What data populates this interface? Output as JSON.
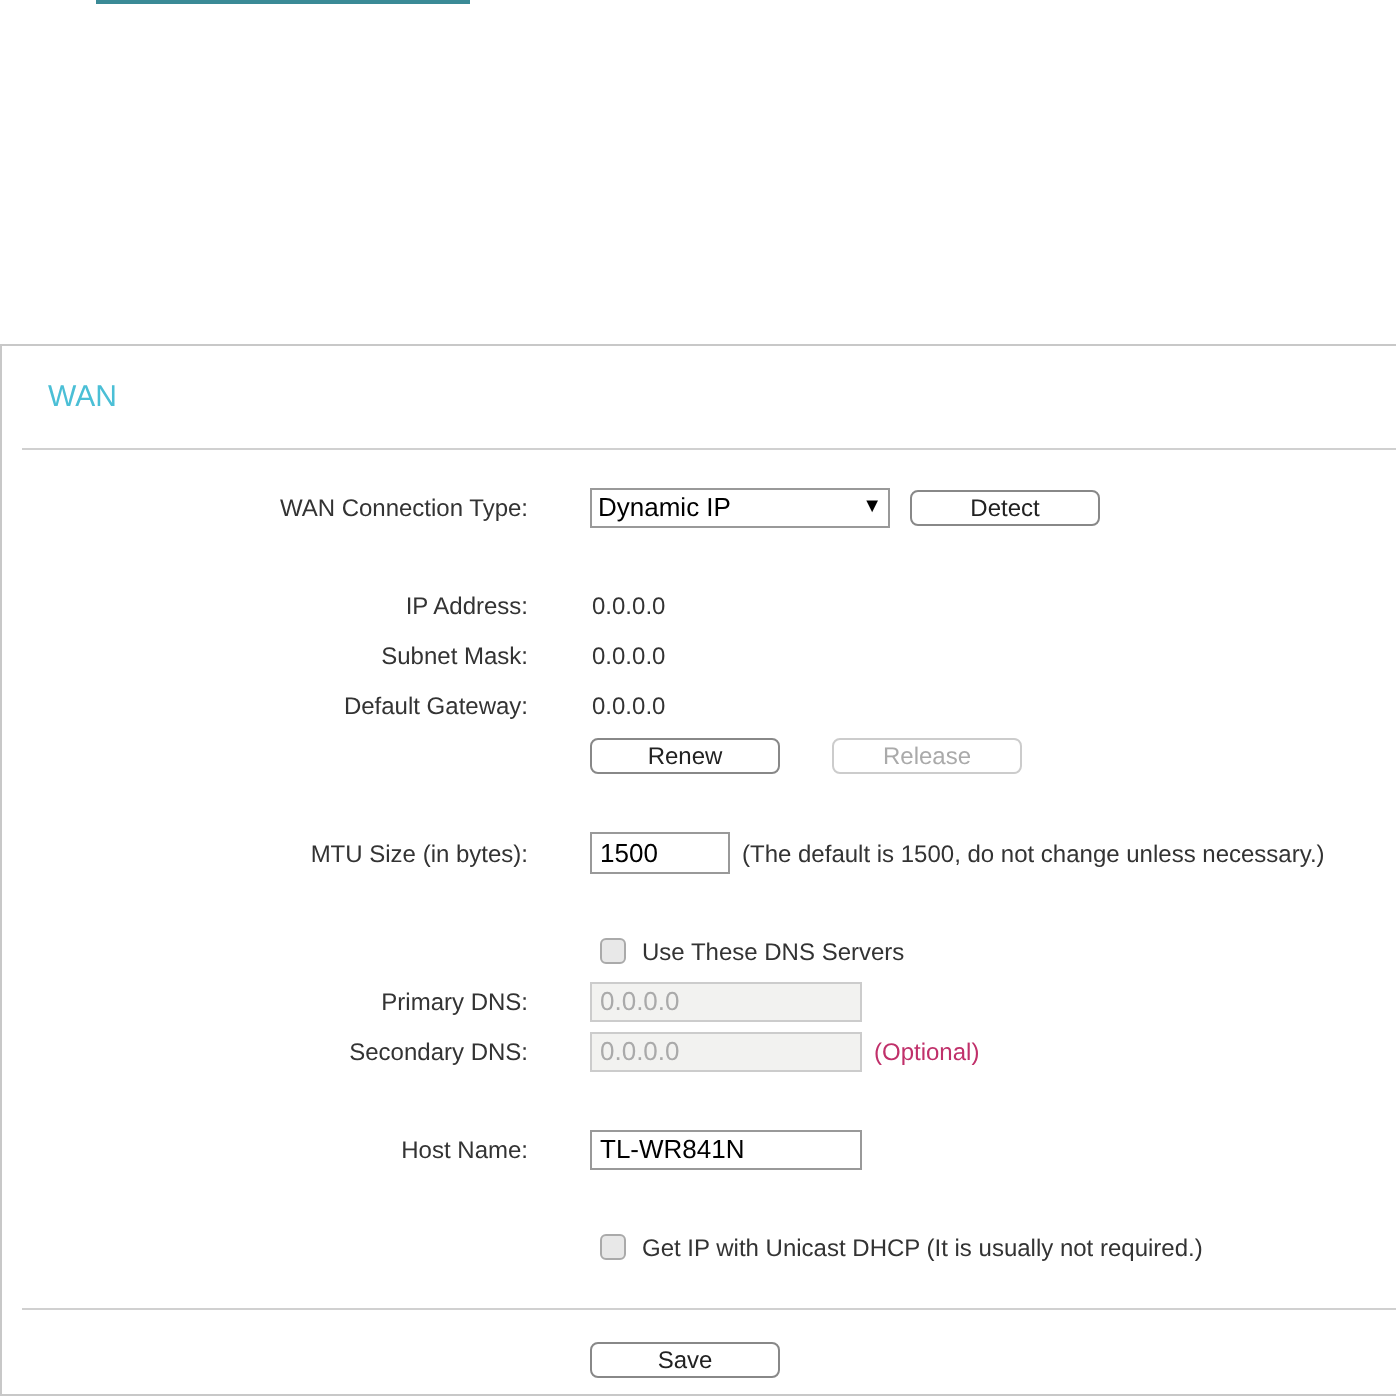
{
  "panel": {
    "title": "WAN"
  },
  "groups": [
    [
      {
        "kind": "select",
        "label": "WAN Connection Type:",
        "value": "Dynamic IP",
        "arrow": "▼",
        "button": {
          "label": "Detect",
          "disabled": false
        }
      }
    ],
    [
      {
        "kind": "info",
        "label": "IP Address:",
        "value": "0.0.0.0"
      },
      {
        "kind": "info",
        "label": "Subnet Mask:",
        "value": "0.0.0.0"
      },
      {
        "kind": "info",
        "label": "Default Gateway:",
        "value": "0.0.0.0"
      },
      {
        "kind": "buttons",
        "buttons": [
          {
            "label": "Renew",
            "disabled": false
          },
          {
            "label": "Release",
            "disabled": true
          }
        ]
      }
    ],
    [
      {
        "kind": "shortfield",
        "label": "MTU Size (in bytes):",
        "value": "1500",
        "disabled": false,
        "note": {
          "text": "(The default is 1500, do not change unless necessary.)",
          "emphasis": false
        }
      }
    ],
    [
      {
        "kind": "checkbox",
        "label": "Use These DNS Servers",
        "checked": false
      },
      {
        "kind": "field",
        "label": "Primary DNS:",
        "value": "0.0.0.0",
        "disabled": true
      },
      {
        "kind": "field",
        "label": "Secondary DNS:",
        "value": "0.0.0.0",
        "disabled": true,
        "note": {
          "text": "(Optional)",
          "emphasis": true
        }
      }
    ],
    [
      {
        "kind": "field",
        "label": "Host Name:",
        "value": "TL-WR841N",
        "disabled": false
      }
    ],
    [
      {
        "kind": "checkbox",
        "label": "Get IP with Unicast DHCP (It is usually not required.)",
        "checked": false
      }
    ]
  ],
  "save": {
    "label": "Save"
  }
}
